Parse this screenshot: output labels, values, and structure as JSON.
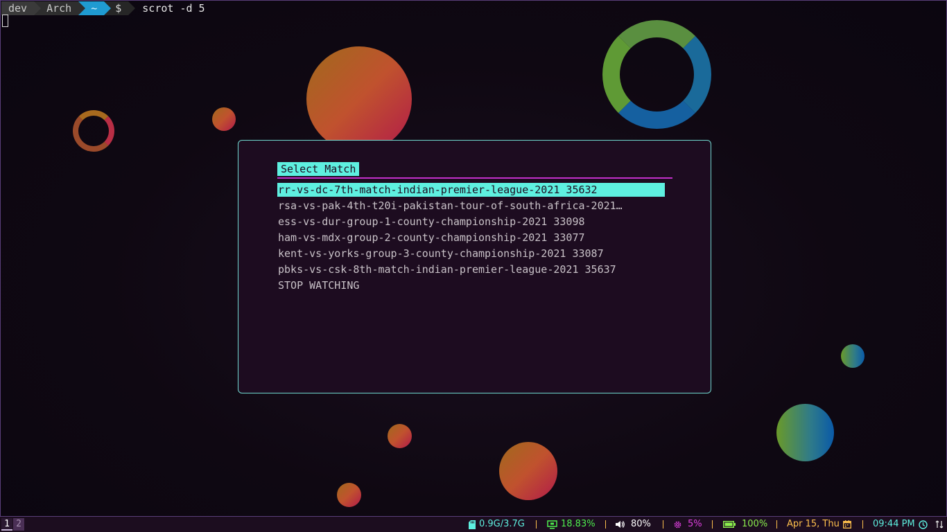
{
  "terminal": {
    "prompt_segments": [
      "dev",
      "Arch",
      "~",
      "$"
    ],
    "command": "scrot -d 5"
  },
  "dialog": {
    "title": "Select Match",
    "items": [
      "rr-vs-dc-7th-match-indian-premier-league-2021 35632",
      "rsa-vs-pak-4th-t20i-pakistan-tour-of-south-africa-2021…",
      "ess-vs-dur-group-1-county-championship-2021 33098",
      "ham-vs-mdx-group-2-county-championship-2021 33077",
      "kent-vs-yorks-group-3-county-championship-2021 33087",
      "pbks-vs-csk-8th-match-indian-premier-league-2021 35637",
      "STOP WATCHING"
    ],
    "selected_index": 0,
    "colors": {
      "accent": "#5ef0e0",
      "underline": "#c230c9",
      "border": "#71d9d0"
    }
  },
  "statusbar": {
    "workspaces": [
      "1",
      "2"
    ],
    "memory": {
      "value": "0.9G/3.7G",
      "icon": "sd-card-icon",
      "color": "#5ef0e0"
    },
    "cpu": {
      "value": "18.83%",
      "icon": "monitor-icon",
      "color": "#4ef04e"
    },
    "volume": {
      "value": "80%",
      "icon": "speaker-icon",
      "color": "#ffffff"
    },
    "brightness": {
      "value": "5%",
      "icon": "gear-icon",
      "color": "#e040e0"
    },
    "battery": {
      "value": "100%",
      "icon": "battery-icon",
      "color": "#8cf04e"
    },
    "date": {
      "value": "Apr 15, Thu",
      "icon": "calendar-icon",
      "color": "#ffc14d"
    },
    "time": {
      "value": "09:44 PM",
      "icon": "clock-icon",
      "color": "#5ef0e0"
    },
    "tray_icon": "network-icon"
  }
}
